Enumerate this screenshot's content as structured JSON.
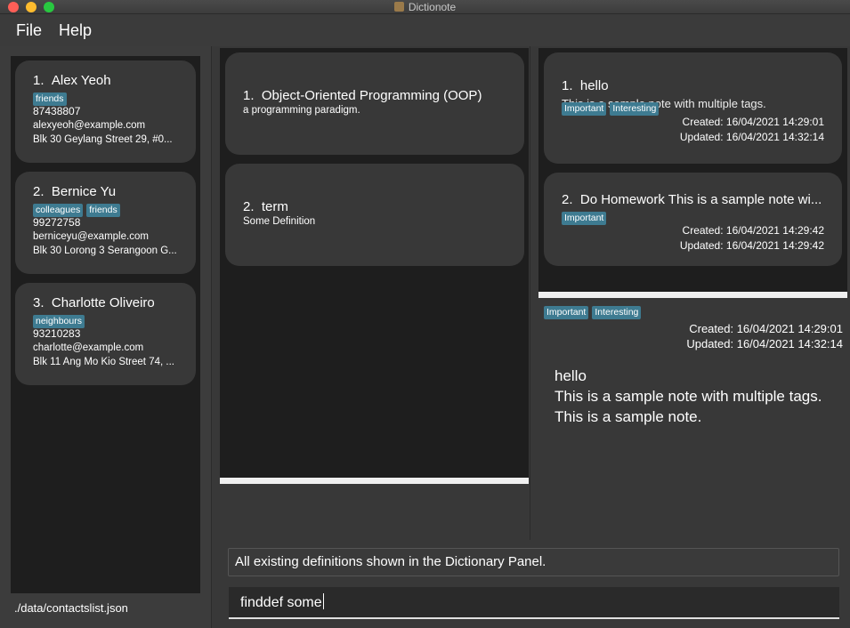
{
  "window": {
    "title": "Dictionote",
    "icon": "app-icon"
  },
  "menu": {
    "file": "File",
    "help": "Help"
  },
  "contacts": [
    {
      "index": "1.",
      "name": "Alex Yeoh",
      "tags": [
        "friends"
      ],
      "phone": "87438807",
      "email": "alexyeoh@example.com",
      "address": "Blk 30 Geylang Street 29, #0..."
    },
    {
      "index": "2.",
      "name": "Bernice Yu",
      "tags": [
        "colleagues",
        "friends"
      ],
      "phone": "99272758",
      "email": "berniceyu@example.com",
      "address": "Blk 30 Lorong 3 Serangoon G..."
    },
    {
      "index": "3.",
      "name": "Charlotte Oliveiro",
      "tags": [
        "neighbours"
      ],
      "phone": "93210283",
      "email": "charlotte@example.com",
      "address": "Blk 11 Ang Mo Kio Street 74, ..."
    }
  ],
  "contacts_file_path": "./data/contactslist.json",
  "definitions": [
    {
      "index": "1.",
      "term": "Object-Oriented Programming (OOP)",
      "definition": "a programming paradigm."
    },
    {
      "index": "2.",
      "term": "term",
      "definition": "Some Definition"
    }
  ],
  "notes": [
    {
      "index": "1.",
      "title": "hello",
      "overflow_text": "This is a sample note with multiple tags.",
      "tags": [
        "Important",
        "Interesting"
      ],
      "created": "Created: 16/04/2021 14:29:01",
      "updated": "Updated: 16/04/2021 14:32:14"
    },
    {
      "index": "2.",
      "title": "Do Homework This is a sample note wi...",
      "tags": [
        "Important"
      ],
      "created": "Created: 16/04/2021 14:29:42",
      "updated": "Updated: 16/04/2021 14:29:42"
    }
  ],
  "note_detail": {
    "tags": [
      "Important",
      "Interesting"
    ],
    "created": "Created: 16/04/2021 14:29:01",
    "updated": "Updated: 16/04/2021 14:32:14",
    "lines": [
      "hello",
      "This is a sample note with multiple tags.",
      "This is a sample note."
    ]
  },
  "result_message": "All existing definitions shown in the Dictionary Panel.",
  "command_input": "finddef some",
  "colors": {
    "tag_background": "#3e7b91",
    "panel_background": "#1e1e1e",
    "card_background": "#383838"
  }
}
